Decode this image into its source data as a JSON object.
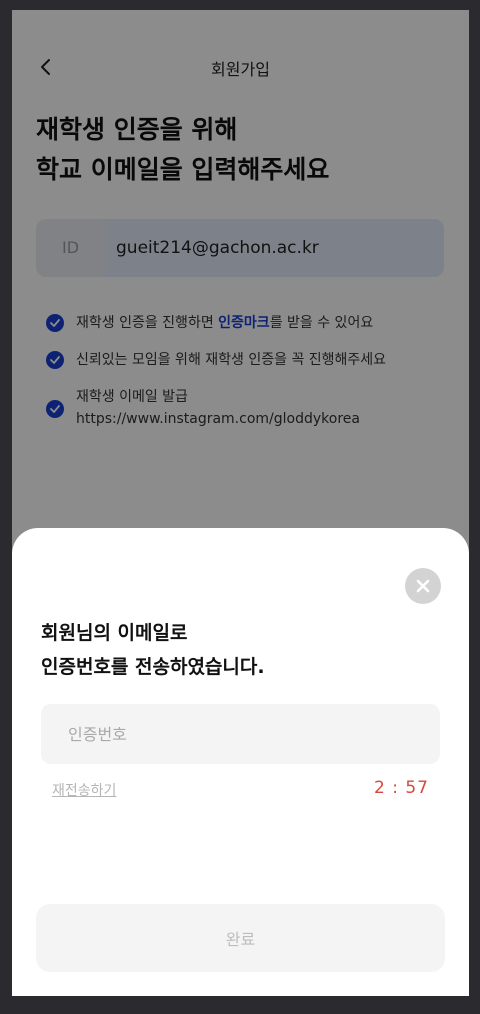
{
  "header": {
    "title": "회원가입",
    "back_icon": "chevron-left-icon"
  },
  "headline": {
    "line1": "재학생 인증을 위해",
    "line2": "학교 이메일을 입력해주세요"
  },
  "id_field": {
    "label": "ID",
    "value": "gueit214@gachon.ac.kr"
  },
  "notes": {
    "item1_before": "재학생 인증을 진행하면 ",
    "item1_highlight": "인증마크",
    "item1_after": "를 받을 수 있어요",
    "item2": "신뢰있는 모임을 위해 재학생 인증을 꼭 진행해주세요",
    "item3_line1": "재학생 이메일 발급",
    "item3_line2": "https://www.instagram.com/gloddykorea"
  },
  "sheet": {
    "title_line1": "회원님의 이메일로",
    "title_line2": "인증번호를 전송하였습니다.",
    "code_placeholder": "인증번호",
    "code_value": "",
    "resend_label": "재전송하기",
    "timer": "2 : 57",
    "done_label": "완료",
    "close_icon": "close-icon"
  },
  "colors": {
    "accent_blue": "#1a3fd1",
    "timer_red": "#d9473a",
    "overlay": "rgba(0,0,0,0.45)"
  }
}
